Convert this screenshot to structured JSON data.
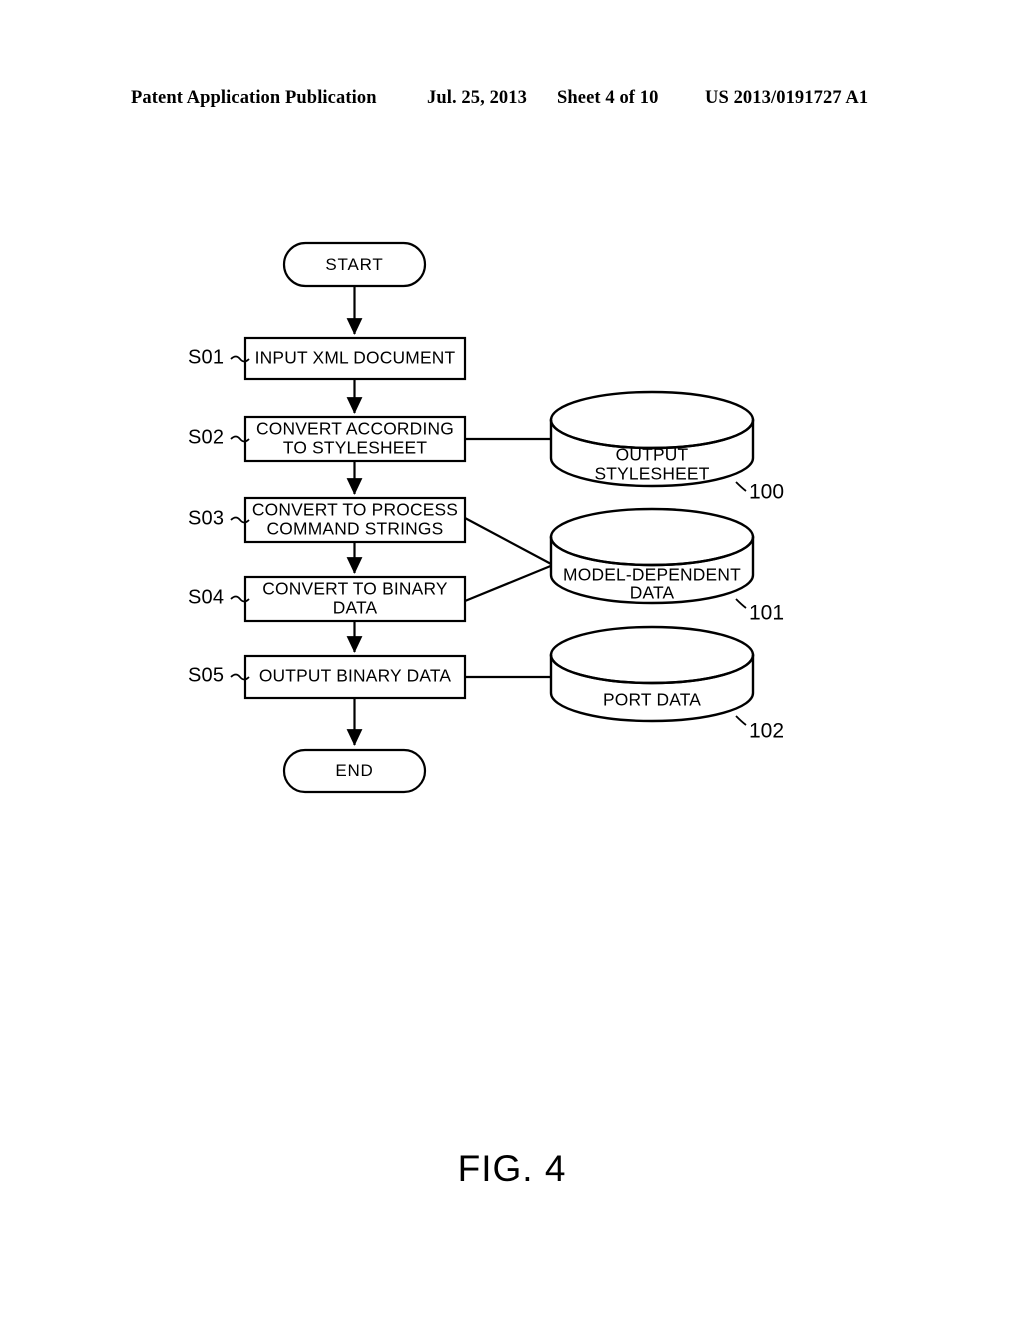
{
  "header": {
    "publication": "Patent Application Publication",
    "date": "Jul. 25, 2013",
    "sheet": "Sheet 4 of 10",
    "number": "US 2013/0191727 A1"
  },
  "figure": {
    "caption": "FIG. 4"
  },
  "flowchart": {
    "start_terminator": "START",
    "end_terminator": "END",
    "steps": [
      {
        "id": "S01",
        "label": "INPUT XML DOCUMENT",
        "lines": [
          "INPUT XML DOCUMENT"
        ]
      },
      {
        "id": "S02",
        "label": "CONVERT ACCORDING TO STYLESHEET",
        "lines": [
          "CONVERT ACCORDING",
          "TO STYLESHEET"
        ]
      },
      {
        "id": "S03",
        "label": "CONVERT TO PROCESS COMMAND STRINGS",
        "lines": [
          "CONVERT TO PROCESS",
          "COMMAND STRINGS"
        ]
      },
      {
        "id": "S04",
        "label": "CONVERT TO BINARY DATA",
        "lines": [
          "CONVERT TO BINARY",
          "DATA"
        ]
      },
      {
        "id": "S05",
        "label": "OUTPUT BINARY DATA",
        "lines": [
          "OUTPUT BINARY DATA"
        ]
      }
    ],
    "data_stores": [
      {
        "ref": "100",
        "label": "OUTPUT STYLESHEET",
        "lines": [
          "OUTPUT",
          "STYLESHEET"
        ]
      },
      {
        "ref": "101",
        "label": "MODEL-DEPENDENT DATA",
        "lines": [
          "MODEL-DEPENDENT",
          "DATA"
        ]
      },
      {
        "ref": "102",
        "label": "PORT DATA",
        "lines": [
          "PORT DATA"
        ]
      }
    ]
  }
}
